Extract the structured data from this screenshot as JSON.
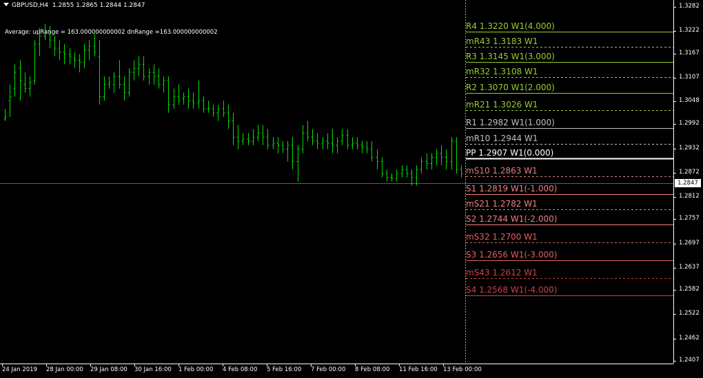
{
  "window": {
    "symbol_title": "GBPUSD,H4",
    "ohlc": "1.2855 1.2865 1.2844 1.2847",
    "indicator_text": "Average: upRange = 163.000000000002 dnRange =163.000000000002"
  },
  "price_axis": {
    "ticks": [
      "1.3282",
      "1.3222",
      "1.3167",
      "1.3107",
      "1.3048",
      "1.2992",
      "1.2932",
      "1.2872",
      "1.2812",
      "1.2757",
      "1.2697",
      "1.2637",
      "1.2582",
      "1.2522",
      "1.2462",
      "1.2407"
    ],
    "current_price": "1.2847"
  },
  "time_axis": {
    "labels": [
      "24 Jan 2019",
      "28 Jan 00:00",
      "29 Jan 08:00",
      "30 Jan 16:00",
      "1 Feb 00:00",
      "4 Feb 08:00",
      "5 Feb 16:00",
      "7 Feb 00:00",
      "8 Feb 08:00",
      "11 Feb 16:00",
      "13 Feb 00:00"
    ]
  },
  "pivot_levels": [
    {
      "label": "R4 1.3220 W1(4.000)",
      "price": 1.322,
      "color": "#9acd32",
      "line": "solid"
    },
    {
      "label": "mR43 1.3183 W1",
      "price": 1.3183,
      "color": "#9acd32",
      "line": "dashed"
    },
    {
      "label": "R3 1.3145 W1(3.000)",
      "price": 1.3145,
      "color": "#9acd32",
      "line": "solid"
    },
    {
      "label": "mR32 1.3108 W1",
      "price": 1.3108,
      "color": "#9acd32",
      "line": "dashed"
    },
    {
      "label": "R2 1.3070 W1(2.000)",
      "price": 1.307,
      "color": "#9acd32",
      "line": "solid"
    },
    {
      "label": "mR21 1.3026 W1",
      "price": 1.3026,
      "color": "#9acd32",
      "line": "dashed"
    },
    {
      "label": "R1 1.2982 W1(1.000)",
      "price": 1.2982,
      "color": "#c0c0c0",
      "line": "solid"
    },
    {
      "label": "mR10 1.2944 W1",
      "price": 1.2944,
      "color": "#c0c0c0",
      "line": "dashed"
    },
    {
      "label": "PP 1.2907 W1(0.000)",
      "price": 1.2907,
      "color": "#ffffff",
      "line": "solid"
    },
    {
      "label": "mS10 1.2863 W1",
      "price": 1.2863,
      "color": "#e08080",
      "line": "dashed"
    },
    {
      "label": "S1 1.2819 W1(-1.000)",
      "price": 1.2819,
      "color": "#f08080",
      "line": "solid"
    },
    {
      "label": "mS21 1.2782 W1",
      "price": 1.2782,
      "color": "#f08080",
      "line": "dashed"
    },
    {
      "label": "S2 1.2744 W1(-2.000)",
      "price": 1.2744,
      "color": "#f08080",
      "line": "solid"
    },
    {
      "label": "mS32 1.2700 W1",
      "price": 1.27,
      "color": "#e06060",
      "line": "dashed"
    },
    {
      "label": "S3 1.2656 W1(-3.000)",
      "price": 1.2656,
      "color": "#e06060",
      "line": "solid"
    },
    {
      "label": "mS43 1.2612 W1",
      "price": 1.2612,
      "color": "#d04040",
      "line": "dashed"
    },
    {
      "label": "S4 1.2568 W1(-4.000)",
      "price": 1.2568,
      "color": "#d04040",
      "line": "solid"
    }
  ],
  "colors": {
    "bars": "#00e000",
    "background": "#000000",
    "grid_dashed": "#c0c000",
    "price_line": "#c0c0c0"
  },
  "chart_data": {
    "type": "ohlc",
    "symbol": "GBPUSD",
    "timeframe": "H4",
    "ylim": [
      1.2407,
      1.3282
    ],
    "grid": false,
    "bars": [
      {
        "o": 1.3005,
        "h": 1.303,
        "l": 1.3,
        "c": 1.301
      },
      {
        "o": 1.305,
        "h": 1.309,
        "l": 1.301,
        "c": 1.306
      },
      {
        "o": 1.308,
        "h": 1.314,
        "l": 1.306,
        "c": 1.312
      },
      {
        "o": 1.313,
        "h": 1.315,
        "l": 1.305,
        "c": 1.31
      },
      {
        "o": 1.309,
        "h": 1.312,
        "l": 1.307,
        "c": 1.308
      },
      {
        "o": 1.308,
        "h": 1.311,
        "l": 1.306,
        "c": 1.3095
      },
      {
        "o": 1.31,
        "h": 1.32,
        "l": 1.309,
        "c": 1.319
      },
      {
        "o": 1.319,
        "h": 1.323,
        "l": 1.316,
        "c": 1.321
      },
      {
        "o": 1.321,
        "h": 1.324,
        "l": 1.32,
        "c": 1.322
      },
      {
        "o": 1.3215,
        "h": 1.3235,
        "l": 1.318,
        "c": 1.32
      },
      {
        "o": 1.32,
        "h": 1.321,
        "l": 1.316,
        "c": 1.318
      },
      {
        "o": 1.318,
        "h": 1.32,
        "l": 1.315,
        "c": 1.317
      },
      {
        "o": 1.317,
        "h": 1.319,
        "l": 1.314,
        "c": 1.3165
      },
      {
        "o": 1.3165,
        "h": 1.318,
        "l": 1.314,
        "c": 1.316
      },
      {
        "o": 1.3155,
        "h": 1.317,
        "l": 1.313,
        "c": 1.315
      },
      {
        "o": 1.315,
        "h": 1.3165,
        "l": 1.312,
        "c": 1.3145
      },
      {
        "o": 1.3145,
        "h": 1.319,
        "l": 1.313,
        "c": 1.3175
      },
      {
        "o": 1.3175,
        "h": 1.32,
        "l": 1.315,
        "c": 1.3185
      },
      {
        "o": 1.3185,
        "h": 1.3215,
        "l": 1.316,
        "c": 1.317
      },
      {
        "o": 1.316,
        "h": 1.32,
        "l": 1.304,
        "c": 1.306
      },
      {
        "o": 1.306,
        "h": 1.311,
        "l": 1.305,
        "c": 1.309
      },
      {
        "o": 1.309,
        "h": 1.311,
        "l": 1.308,
        "c": 1.3095
      },
      {
        "o": 1.309,
        "h": 1.312,
        "l": 1.307,
        "c": 1.311
      },
      {
        "o": 1.311,
        "h": 1.315,
        "l": 1.308,
        "c": 1.309
      },
      {
        "o": 1.309,
        "h": 1.311,
        "l": 1.305,
        "c": 1.307
      },
      {
        "o": 1.307,
        "h": 1.313,
        "l": 1.306,
        "c": 1.312
      },
      {
        "o": 1.312,
        "h": 1.315,
        "l": 1.31,
        "c": 1.313
      },
      {
        "o": 1.313,
        "h": 1.316,
        "l": 1.311,
        "c": 1.314
      },
      {
        "o": 1.314,
        "h": 1.316,
        "l": 1.31,
        "c": 1.311
      },
      {
        "o": 1.311,
        "h": 1.313,
        "l": 1.309,
        "c": 1.312
      },
      {
        "o": 1.312,
        "h": 1.314,
        "l": 1.309,
        "c": 1.311
      },
      {
        "o": 1.311,
        "h": 1.313,
        "l": 1.308,
        "c": 1.309
      },
      {
        "o": 1.309,
        "h": 1.311,
        "l": 1.307,
        "c": 1.31
      },
      {
        "o": 1.31,
        "h": 1.311,
        "l": 1.302,
        "c": 1.304
      },
      {
        "o": 1.304,
        "h": 1.308,
        "l": 1.303,
        "c": 1.306
      },
      {
        "o": 1.306,
        "h": 1.309,
        "l": 1.304,
        "c": 1.305
      },
      {
        "o": 1.3055,
        "h": 1.307,
        "l": 1.304,
        "c": 1.306
      },
      {
        "o": 1.306,
        "h": 1.308,
        "l": 1.303,
        "c": 1.305
      },
      {
        "o": 1.305,
        "h": 1.307,
        "l": 1.303,
        "c": 1.3045
      },
      {
        "o": 1.3045,
        "h": 1.31,
        "l": 1.303,
        "c": 1.305
      },
      {
        "o": 1.305,
        "h": 1.306,
        "l": 1.302,
        "c": 1.303
      },
      {
        "o": 1.303,
        "h": 1.305,
        "l": 1.302,
        "c": 1.303
      },
      {
        "o": 1.303,
        "h": 1.304,
        "l": 1.301,
        "c": 1.302
      },
      {
        "o": 1.302,
        "h": 1.304,
        "l": 1.3,
        "c": 1.303
      },
      {
        "o": 1.303,
        "h": 1.305,
        "l": 1.301,
        "c": 1.302
      },
      {
        "o": 1.302,
        "h": 1.304,
        "l": 1.298,
        "c": 1.3
      },
      {
        "o": 1.3,
        "h": 1.302,
        "l": 1.294,
        "c": 1.296
      },
      {
        "o": 1.296,
        "h": 1.299,
        "l": 1.293,
        "c": 1.295
      },
      {
        "o": 1.295,
        "h": 1.297,
        "l": 1.294,
        "c": 1.2955
      },
      {
        "o": 1.2955,
        "h": 1.297,
        "l": 1.294,
        "c": 1.295
      },
      {
        "o": 1.295,
        "h": 1.298,
        "l": 1.294,
        "c": 1.296
      },
      {
        "o": 1.296,
        "h": 1.299,
        "l": 1.295,
        "c": 1.297
      },
      {
        "o": 1.297,
        "h": 1.299,
        "l": 1.294,
        "c": 1.296
      },
      {
        "o": 1.296,
        "h": 1.298,
        "l": 1.293,
        "c": 1.294
      },
      {
        "o": 1.294,
        "h": 1.296,
        "l": 1.293,
        "c": 1.2945
      },
      {
        "o": 1.2945,
        "h": 1.296,
        "l": 1.292,
        "c": 1.294
      },
      {
        "o": 1.294,
        "h": 1.295,
        "l": 1.292,
        "c": 1.293
      },
      {
        "o": 1.293,
        "h": 1.295,
        "l": 1.29,
        "c": 1.294
      },
      {
        "o": 1.294,
        "h": 1.296,
        "l": 1.288,
        "c": 1.29
      },
      {
        "o": 1.29,
        "h": 1.294,
        "l": 1.285,
        "c": 1.293
      },
      {
        "o": 1.293,
        "h": 1.299,
        "l": 1.292,
        "c": 1.297
      },
      {
        "o": 1.297,
        "h": 1.3,
        "l": 1.295,
        "c": 1.296
      },
      {
        "o": 1.296,
        "h": 1.298,
        "l": 1.294,
        "c": 1.295
      },
      {
        "o": 1.295,
        "h": 1.297,
        "l": 1.293,
        "c": 1.2945
      },
      {
        "o": 1.2945,
        "h": 1.296,
        "l": 1.293,
        "c": 1.295
      },
      {
        "o": 1.295,
        "h": 1.297,
        "l": 1.293,
        "c": 1.2945
      },
      {
        "o": 1.2945,
        "h": 1.298,
        "l": 1.292,
        "c": 1.294
      },
      {
        "o": 1.294,
        "h": 1.296,
        "l": 1.292,
        "c": 1.295
      },
      {
        "o": 1.295,
        "h": 1.298,
        "l": 1.294,
        "c": 1.2965
      },
      {
        "o": 1.2965,
        "h": 1.298,
        "l": 1.293,
        "c": 1.294
      },
      {
        "o": 1.294,
        "h": 1.296,
        "l": 1.293,
        "c": 1.2945
      },
      {
        "o": 1.2945,
        "h": 1.296,
        "l": 1.293,
        "c": 1.294
      },
      {
        "o": 1.294,
        "h": 1.295,
        "l": 1.292,
        "c": 1.2935
      },
      {
        "o": 1.2935,
        "h": 1.295,
        "l": 1.292,
        "c": 1.293
      },
      {
        "o": 1.293,
        "h": 1.295,
        "l": 1.29,
        "c": 1.291
      },
      {
        "o": 1.291,
        "h": 1.293,
        "l": 1.288,
        "c": 1.29
      },
      {
        "o": 1.29,
        "h": 1.291,
        "l": 1.286,
        "c": 1.287
      },
      {
        "o": 1.287,
        "h": 1.288,
        "l": 1.285,
        "c": 1.286
      },
      {
        "o": 1.286,
        "h": 1.287,
        "l": 1.285,
        "c": 1.2858
      },
      {
        "o": 1.2858,
        "h": 1.288,
        "l": 1.285,
        "c": 1.287
      },
      {
        "o": 1.287,
        "h": 1.289,
        "l": 1.286,
        "c": 1.288
      },
      {
        "o": 1.288,
        "h": 1.289,
        "l": 1.286,
        "c": 1.287
      },
      {
        "o": 1.287,
        "h": 1.288,
        "l": 1.284,
        "c": 1.286
      },
      {
        "o": 1.286,
        "h": 1.289,
        "l": 1.284,
        "c": 1.288
      },
      {
        "o": 1.288,
        "h": 1.291,
        "l": 1.287,
        "c": 1.29
      },
      {
        "o": 1.29,
        "h": 1.292,
        "l": 1.288,
        "c": 1.2895
      },
      {
        "o": 1.2895,
        "h": 1.292,
        "l": 1.288,
        "c": 1.291
      },
      {
        "o": 1.291,
        "h": 1.293,
        "l": 1.289,
        "c": 1.292
      },
      {
        "o": 1.292,
        "h": 1.294,
        "l": 1.289,
        "c": 1.291
      },
      {
        "o": 1.291,
        "h": 1.293,
        "l": 1.288,
        "c": 1.29
      },
      {
        "o": 1.29,
        "h": 1.296,
        "l": 1.288,
        "c": 1.295
      },
      {
        "o": 1.295,
        "h": 1.296,
        "l": 1.287,
        "c": 1.288
      },
      {
        "o": 1.288,
        "h": 1.289,
        "l": 1.286,
        "c": 1.287
      }
    ]
  }
}
